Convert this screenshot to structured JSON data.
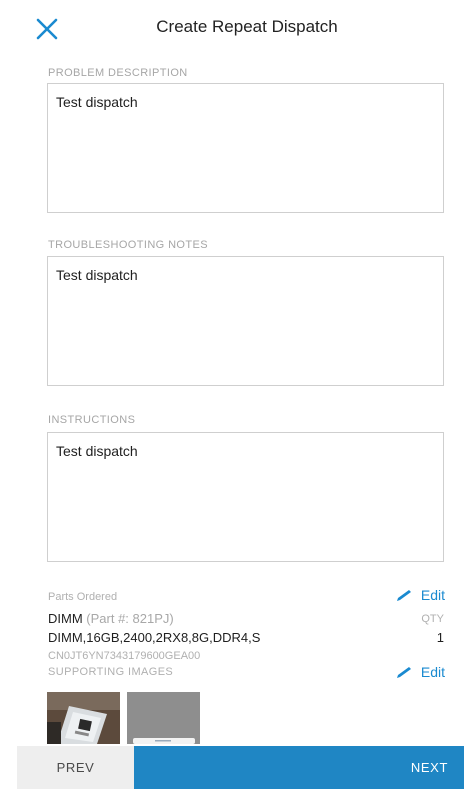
{
  "header": {
    "title": "Create Repeat Dispatch",
    "close_icon": "close-icon",
    "accent_color": "#1a8ad0"
  },
  "problem": {
    "label": "PROBLEM DESCRIPTION",
    "value": "Test dispatch"
  },
  "troubleshooting": {
    "label": "TROUBLESHOOTING NOTES",
    "value": "Test dispatch"
  },
  "instructions": {
    "label": "INSTRUCTIONS",
    "value": "Test dispatch"
  },
  "parts": {
    "label": "Parts Ordered",
    "edit_label": "Edit",
    "name": "DIMM",
    "part_number": "(Part #: 821PJ)",
    "qty_label": "QTY",
    "description": "DIMM,16GB,2400,2RX8,8G,DDR4,S",
    "qty": "1",
    "serial": "CN0JT6YN7343179600GEA00"
  },
  "images": {
    "label": "SUPPORTING IMAGES",
    "edit_label": "Edit"
  },
  "footer": {
    "prev_label": "PREV",
    "next_label": "NEXT",
    "next_color": "#1f86c4"
  }
}
